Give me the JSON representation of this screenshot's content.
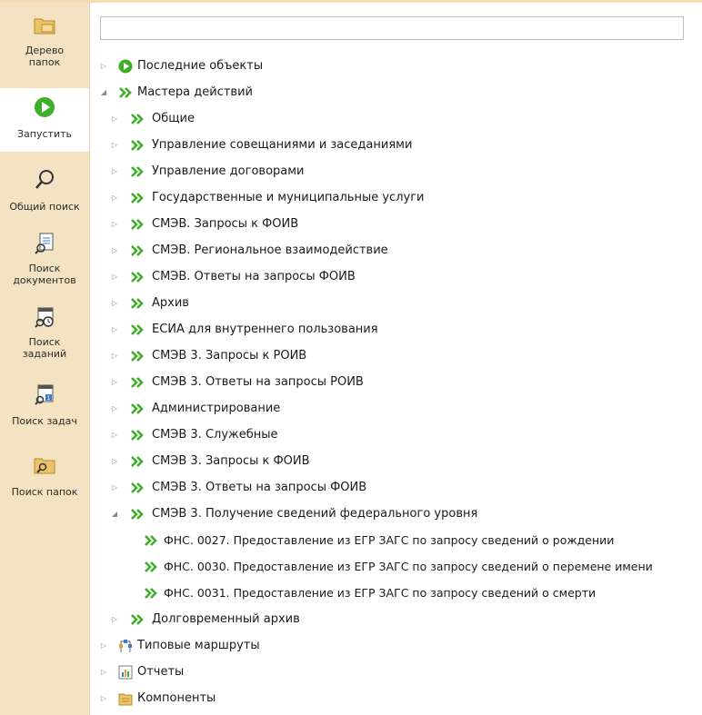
{
  "sidebar": {
    "items": [
      {
        "name": "sidebar-item-folder-tree",
        "icon": "folder-tree-icon",
        "label": "Дерево\nпапок",
        "active": false
      },
      {
        "name": "sidebar-item-run",
        "icon": "play-icon",
        "label": "Запустить",
        "active": true
      },
      {
        "name": "sidebar-item-general-search",
        "icon": "magnifier-icon",
        "label": "Общий поиск",
        "active": false
      },
      {
        "name": "sidebar-item-document-search",
        "icon": "document-search-icon",
        "label": "Поиск\nдокументов",
        "active": false
      },
      {
        "name": "sidebar-item-assignment-search",
        "icon": "assignment-search-icon",
        "label": "Поиск\nзаданий",
        "active": false
      },
      {
        "name": "sidebar-item-task-search",
        "icon": "task-search-icon",
        "label": "Поиск задач",
        "active": false
      },
      {
        "name": "sidebar-item-folder-search",
        "icon": "folder-search-icon",
        "label": "Поиск папок",
        "active": false
      }
    ]
  },
  "search": {
    "value": "",
    "placeholder": ""
  },
  "tree": {
    "items": [
      {
        "label": "Последние объекты",
        "icon": "green-play-icon",
        "level": 0,
        "toggle": "collapsed"
      },
      {
        "label": "Мастера действий",
        "icon": "double-chevron-icon",
        "level": 0,
        "toggle": "expanded"
      },
      {
        "label": "Общие",
        "icon": "double-chevron-icon",
        "level": 1,
        "toggle": "collapsed"
      },
      {
        "label": "Управление совещаниями и заседаниями",
        "icon": "double-chevron-icon",
        "level": 1,
        "toggle": "collapsed"
      },
      {
        "label": "Управление договорами",
        "icon": "double-chevron-icon",
        "level": 1,
        "toggle": "collapsed"
      },
      {
        "label": "Государственные и муниципальные услуги",
        "icon": "double-chevron-icon",
        "level": 1,
        "toggle": "collapsed"
      },
      {
        "label": "СМЭВ. Запросы к ФОИВ",
        "icon": "double-chevron-icon",
        "level": 1,
        "toggle": "collapsed"
      },
      {
        "label": "СМЭВ. Региональное взаимодействие",
        "icon": "double-chevron-icon",
        "level": 1,
        "toggle": "collapsed"
      },
      {
        "label": "СМЭВ. Ответы на запросы ФОИВ",
        "icon": "double-chevron-icon",
        "level": 1,
        "toggle": "collapsed"
      },
      {
        "label": "Архив",
        "icon": "double-chevron-icon",
        "level": 1,
        "toggle": "collapsed"
      },
      {
        "label": "ЕСИА для внутреннего пользования",
        "icon": "double-chevron-icon",
        "level": 1,
        "toggle": "collapsed"
      },
      {
        "label": "СМЭВ 3. Запросы к РОИВ",
        "icon": "double-chevron-icon",
        "level": 1,
        "toggle": "collapsed"
      },
      {
        "label": "СМЭВ 3. Ответы на запросы РОИВ",
        "icon": "double-chevron-icon",
        "level": 1,
        "toggle": "collapsed"
      },
      {
        "label": "Администрирование",
        "icon": "double-chevron-icon",
        "level": 1,
        "toggle": "collapsed"
      },
      {
        "label": "СМЭВ 3. Служебные",
        "icon": "double-chevron-icon",
        "level": 1,
        "toggle": "collapsed"
      },
      {
        "label": "СМЭВ 3. Запросы к ФОИВ",
        "icon": "double-chevron-icon",
        "level": 1,
        "toggle": "collapsed"
      },
      {
        "label": "СМЭВ 3. Ответы на запросы ФОИВ",
        "icon": "double-chevron-icon",
        "level": 1,
        "toggle": "collapsed"
      },
      {
        "label": "СМЭВ 3. Получение сведений федерального уровня",
        "icon": "double-chevron-icon",
        "level": 1,
        "toggle": "expanded"
      },
      {
        "label": "ФНС. 0027. Предоставление из ЕГР ЗАГС по запросу сведений о рождении",
        "icon": "double-chevron-icon",
        "level": 2,
        "toggle": "none"
      },
      {
        "label": "ФНС. 0030. Предоставление из ЕГР ЗАГС по запросу сведений о перемене имени",
        "icon": "double-chevron-icon",
        "level": 2,
        "toggle": "none"
      },
      {
        "label": "ФНС. 0031. Предоставление из ЕГР ЗАГС по запросу сведений о смерти",
        "icon": "double-chevron-icon",
        "level": 2,
        "toggle": "none"
      },
      {
        "label": "Долговременный архив",
        "icon": "double-chevron-icon",
        "level": 1,
        "toggle": "collapsed"
      },
      {
        "label": "Типовые маршруты",
        "icon": "route-icon",
        "level": 0,
        "toggle": "collapsed"
      },
      {
        "label": "Отчеты",
        "icon": "report-icon",
        "level": 0,
        "toggle": "collapsed"
      },
      {
        "label": "Компоненты",
        "icon": "components-icon",
        "level": 0,
        "toggle": "collapsed"
      }
    ]
  },
  "colors": {
    "sidebar_bg": "#f4e3c3",
    "accent_green": "#3fae2a",
    "toggle_gray": "#8c8c8c"
  }
}
